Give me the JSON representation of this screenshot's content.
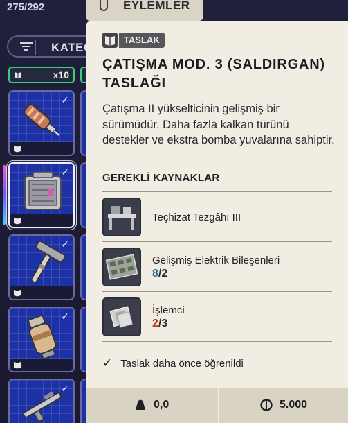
{
  "inventory": {
    "count": "275/292",
    "category_label": "KATEG",
    "filter_chip_count": "x10"
  },
  "actions_tab": {
    "label": "EYLEMLER"
  },
  "item": {
    "badge": "TASLAK",
    "title": "ÇATIŞMA MOD. 3 (SALDIRGAN) TASLAĞI",
    "description": "Çatışma II yükseltici̇nin gelişmiş bir sürümüdür. Daha fazla kalkan türünü destekler ve ekstra bomba yuvalarına sahiptir.",
    "requirements_title": "GEREKLİ KAYNAKLAR",
    "requirements": [
      {
        "name": "Teçhizat Tezgâhı III",
        "have": "",
        "need": "",
        "icon": "workbench-icon"
      },
      {
        "name": "Gelişmiş Elektrik Bileşenleri",
        "have": "8",
        "need": "2",
        "icon": "circuit-board-icon"
      },
      {
        "name": "İşlemci",
        "have": "2",
        "need": "3",
        "icon": "processor-chip-icon"
      }
    ],
    "learned_text": "Taslak daha önce öğrenildi",
    "weight": "0,0",
    "price": "5.000"
  },
  "colors": {
    "have_enough": "#2c6d9e",
    "have_short": "#c1341f",
    "tile_bg": "#1d31a6",
    "card_bg": "#f1ede2"
  }
}
